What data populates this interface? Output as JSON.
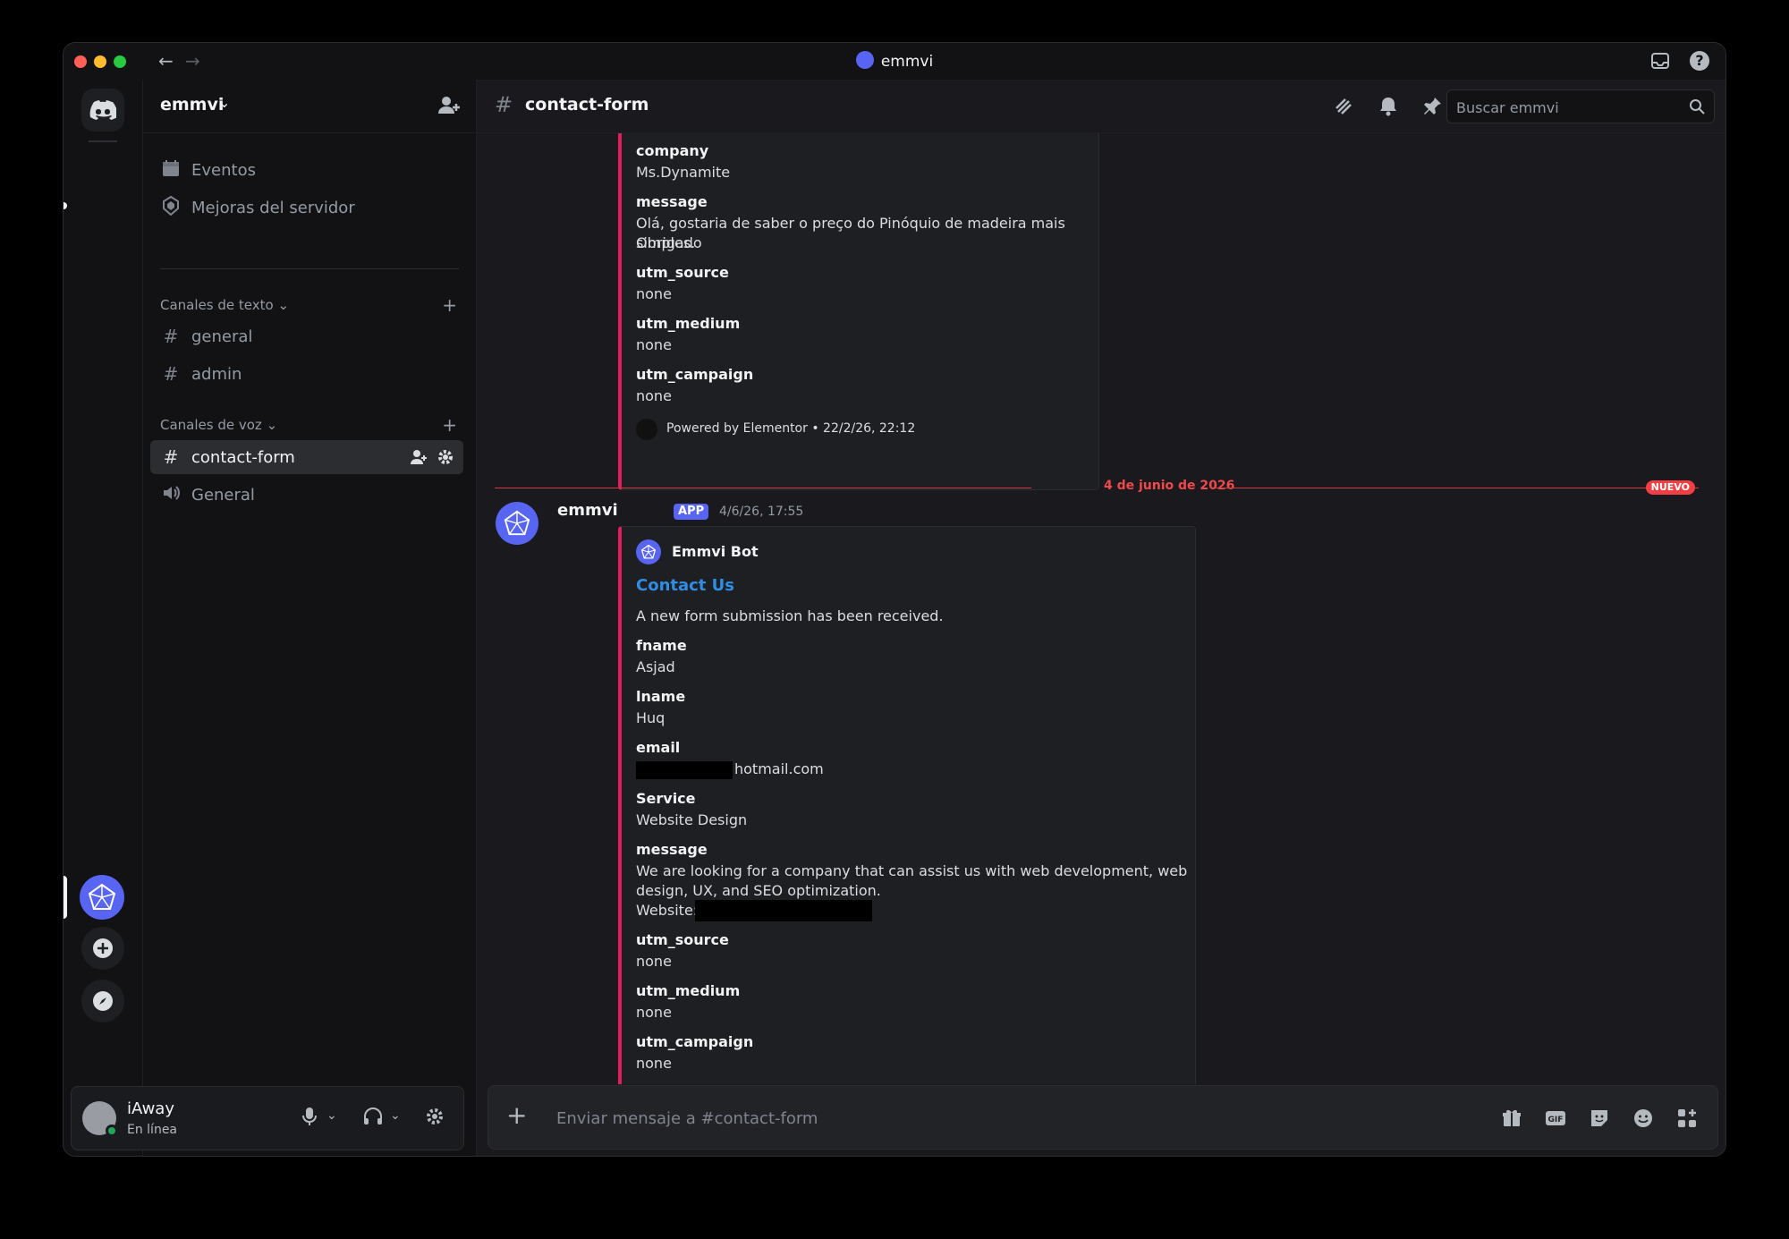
{
  "window": {
    "title": "emmvi"
  },
  "server": {
    "name": "emmvi"
  },
  "sidebar": {
    "top_items": [
      {
        "label": "Eventos"
      },
      {
        "label": "Mejoras del servidor"
      }
    ],
    "text_category": "Canales de texto",
    "text_channels": [
      {
        "label": "general"
      },
      {
        "label": "admin"
      }
    ],
    "voice_category": "Canales de voz",
    "voice_channels": [
      {
        "label": "contact-form"
      },
      {
        "label": "General"
      }
    ]
  },
  "user": {
    "name": "iAway",
    "status": "En línea"
  },
  "channel": {
    "name": "contact-form"
  },
  "search": {
    "placeholder": "Buscar emmvi"
  },
  "embed1": {
    "fields": [
      {
        "name": "company",
        "value": "Ms.Dynamite"
      },
      {
        "name": "message",
        "value_line1": "Olá, gostaria de saber o preço do Pinóquio de madeira mais simples.",
        "value_line2": "Obrigado"
      },
      {
        "name": "utm_source",
        "value": "none"
      },
      {
        "name": "utm_medium",
        "value": "none"
      },
      {
        "name": "utm_campaign",
        "value": "none"
      }
    ],
    "footer": "Powered by Elementor • 22/2/26, 22:12"
  },
  "divider": {
    "date": "4 de junio de 2026",
    "badge": "NUEVO"
  },
  "message2": {
    "author": "emmvi",
    "tag": "APP",
    "timestamp": "4/6/26, 17:55",
    "embed_author": "Emmvi Bot",
    "embed_title": "Contact Us",
    "embed_description": "A new form submission has been received.",
    "fields": [
      {
        "name": "fname",
        "value": "Asjad"
      },
      {
        "name": "lname",
        "value": "Huq"
      },
      {
        "name": "email",
        "value": "hotmail.com"
      },
      {
        "name": "Service",
        "value": "Website Design"
      },
      {
        "name": "message",
        "value_line1": "We are looking for a company that can assist us with web development, web",
        "value_line2": "design, UX, and SEO optimization.",
        "value_line3": "Website:"
      },
      {
        "name": "utm_source",
        "value": "none"
      },
      {
        "name": "utm_medium",
        "value": "none"
      },
      {
        "name": "utm_campaign",
        "value": "none"
      }
    ]
  },
  "composer": {
    "placeholder": "Enviar mensaje a #contact-form"
  },
  "colors": {
    "accent": "#5865f2",
    "embed_border": "#e01e5a",
    "new_divider": "#f23f43",
    "online": "#23a55a"
  },
  "icons": [
    "discord-icon",
    "invite-icon",
    "calendar-icon",
    "shield-icon",
    "hash-icon",
    "speaker-icon",
    "threads-icon",
    "bell-icon",
    "pin-icon",
    "members-icon",
    "search-icon",
    "mic-icon",
    "headphones-icon",
    "gear-icon",
    "gift-icon",
    "gif-icon",
    "sticker-icon",
    "emoji-icon",
    "apps-icon"
  ]
}
